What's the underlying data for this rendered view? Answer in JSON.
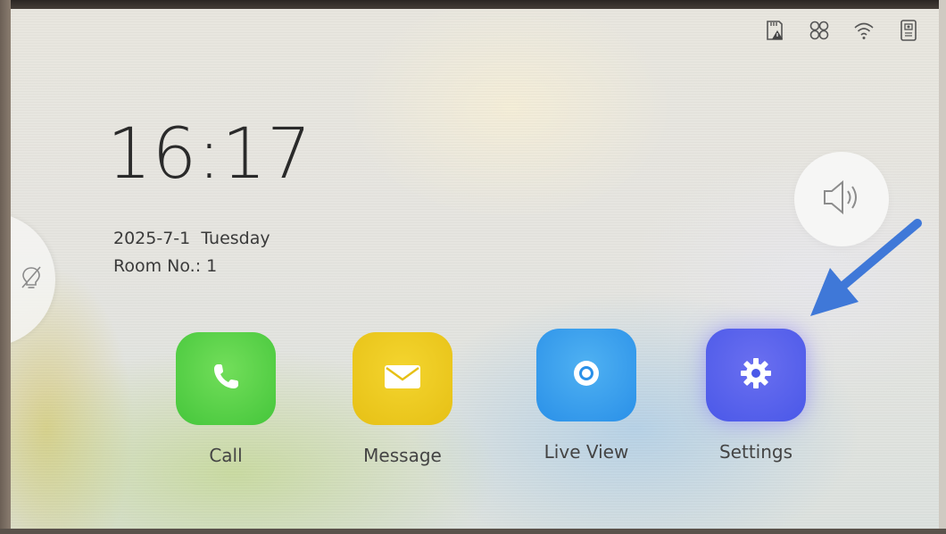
{
  "status_bar": {
    "icons": [
      "sd-card-warning-icon",
      "link-icon",
      "wifi-icon",
      "door-station-icon"
    ]
  },
  "home": {
    "time": "16:17",
    "date": "2025-7-1  Tuesday",
    "room": "Room No.: 1"
  },
  "side_tab": {
    "icon": "light-off-icon"
  },
  "volume": {
    "icon": "speaker-icon"
  },
  "apps": [
    {
      "label": "Call",
      "icon": "phone-icon",
      "color": "#52cf45"
    },
    {
      "label": "Message",
      "icon": "envelope-icon",
      "color": "#eccb20"
    },
    {
      "label": "Live View",
      "icon": "camera-icon",
      "color": "#38a0ee"
    },
    {
      "label": "Settings",
      "icon": "gear-icon",
      "color": "#5660ec"
    }
  ],
  "annotation": {
    "arrow_color": "#3f78d8",
    "arrow_target": "Settings"
  }
}
